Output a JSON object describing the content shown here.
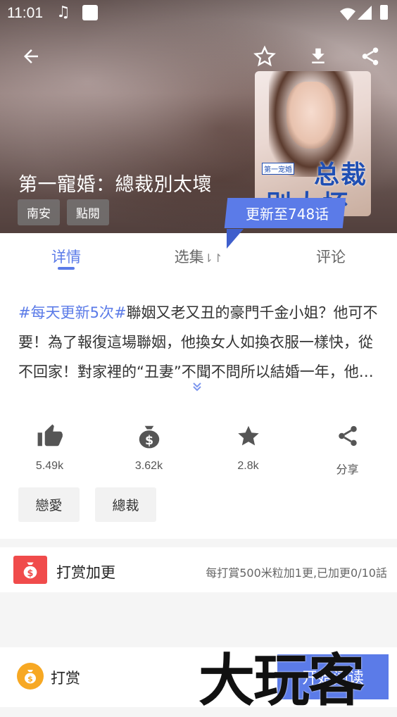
{
  "status_bar": {
    "time": "11:01"
  },
  "header": {
    "title": "第一寵婚：總裁別太壞",
    "tags": [
      "南安",
      "點閱"
    ],
    "update_badge": "更新至748话",
    "cover": {
      "series_label": "第一宠婚",
      "title_line1": "总裁",
      "title_line2": "别太坏"
    }
  },
  "tabs": [
    {
      "label": "详情",
      "active": true
    },
    {
      "label": "选集",
      "active": false
    },
    {
      "label": "评论",
      "active": false
    }
  ],
  "description": {
    "hashtag": "#每天更新5次#",
    "text": "聯姻又老又丑的豪門千金小姐？他可不要！為了報復這場聯姻，他換女人如換衣服一樣快，從不回家！對家裡的“丑妻”不聞不問所以結婚一年，他甚至不知道自己的妻子長什麼樣子……"
  },
  "stats": [
    {
      "icon": "thumb-up-icon",
      "value": "5.49k"
    },
    {
      "icon": "money-bag-icon",
      "value": "3.62k"
    },
    {
      "icon": "star-icon",
      "value": "2.8k"
    },
    {
      "icon": "share-icon",
      "value": "分享"
    }
  ],
  "genres": [
    "戀愛",
    "總裁"
  ],
  "reward": {
    "title": "打赏加更",
    "note": "每打賞500米粒加1更,已加更0/10話"
  },
  "bottom_bar": {
    "tip_label": "打赏",
    "start_label": "开始阅读"
  },
  "watermark": "大玩客",
  "colors": {
    "accent": "#5b7be8",
    "reward_red": "#f04b4b",
    "tip_orange": "#f7a823"
  }
}
